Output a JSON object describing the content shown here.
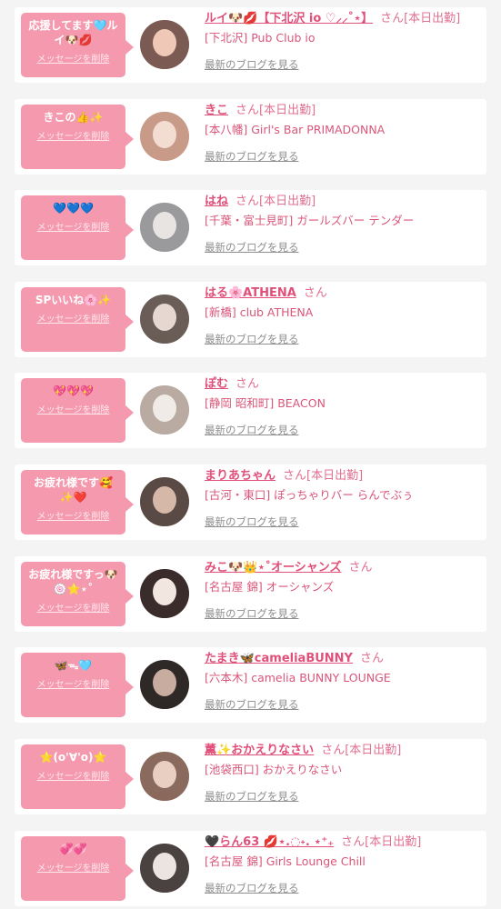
{
  "cards": [
    {
      "message": "応援してます🩵ル\nイ🐶💋",
      "delete_label": "メッセージを削除",
      "name": "ルイ🐶💋【下北沢 io ♡⸝⸝˚⋆】",
      "suffix": "さん[本日出勤]",
      "shop": "[下北沢] Pub Club io",
      "blog_label": "最新のブログを見る",
      "avatar_colors": [
        "#7a5a52",
        "#f0c8b8"
      ]
    },
    {
      "message": "きこの👍✨",
      "delete_label": "メッセージを削除",
      "name": "きこ",
      "suffix": "さん[本日出勤]",
      "shop": "[本八幡] Girl's Bar PRIMADONNA",
      "blog_label": "最新のブログを見る",
      "avatar_colors": [
        "#c89a88",
        "#f3ddd3"
      ]
    },
    {
      "message": "💙💙💙",
      "delete_label": "メッセージを削除",
      "name": "はね",
      "suffix": "さん[本日出勤]",
      "shop": "[千葉・富士見町] ガールズバー テンダー",
      "blog_label": "最新のブログを見る",
      "avatar_colors": [
        "#9a9a9c",
        "#e8e4e2"
      ]
    },
    {
      "message": "SPいいね🌸✨",
      "delete_label": "メッセージを削除",
      "name": "はる🌸ATHENA",
      "suffix": "さん",
      "shop": "[新橋] club ATHENA",
      "blog_label": "最新のブログを見る",
      "avatar_colors": [
        "#6a5c56",
        "#e6d8d0"
      ]
    },
    {
      "message": "💖💖💖",
      "delete_label": "メッセージを削除",
      "name": "ぽむ",
      "suffix": "さん",
      "shop": "[静岡 昭和町] BEACON",
      "blog_label": "最新のブログを見る",
      "avatar_colors": [
        "#b9aba2",
        "#f0ebe6"
      ]
    },
    {
      "message": "お疲れ様です🥰\n✨❤️",
      "delete_label": "メッセージを削除",
      "name": "まりあちゃん",
      "suffix": "さん[本日出勤]",
      "shop": "[古河・東口] ぽっちゃりバー らんでぶぅ",
      "blog_label": "最新のブログを見る",
      "avatar_colors": [
        "#5a4a46",
        "#d6b8a8"
      ]
    },
    {
      "message": "お疲れ様ですっ🐶\n🍥⭐⋆˚",
      "delete_label": "メッセージを削除",
      "name": "みこ🐶👑⋆˚オーシャンズ",
      "suffix": "さん",
      "shop": "[名古屋 錦] オーシャンズ",
      "blog_label": "最新のブログを見る",
      "avatar_colors": [
        "#3a2c2a",
        "#f2e6e0"
      ]
    },
    {
      "message": "🦋ᯓ🩵",
      "delete_label": "メッセージを削除",
      "name": "たまき🦋cameliaBUNNY",
      "suffix": "さん",
      "shop": "[六本木] camelia BUNNY LOUNGE",
      "blog_label": "最新のブログを見る",
      "avatar_colors": [
        "#2e2826",
        "#c8aca0"
      ]
    },
    {
      "message": "⭐(o'∀'o)⭐",
      "delete_label": "メッセージを削除",
      "name": "薫✨おかえりなさい",
      "suffix": "さん[本日出勤]",
      "shop": "[池袋西口] おかえりなさい",
      "blog_label": "最新のブログを見る",
      "avatar_colors": [
        "#8a6a5c",
        "#e9cfc2"
      ]
    },
    {
      "message": "💞💞",
      "delete_label": "メッセージを削除",
      "name": "🖤らん63 💋⋆.◌˖. ⋆⁺₊",
      "suffix": "さん[本日出勤]",
      "shop": "[名古屋 錦] Girls Lounge Chill",
      "blog_label": "最新のブログを見る",
      "avatar_colors": [
        "#4a4240",
        "#ece4e0"
      ]
    }
  ]
}
